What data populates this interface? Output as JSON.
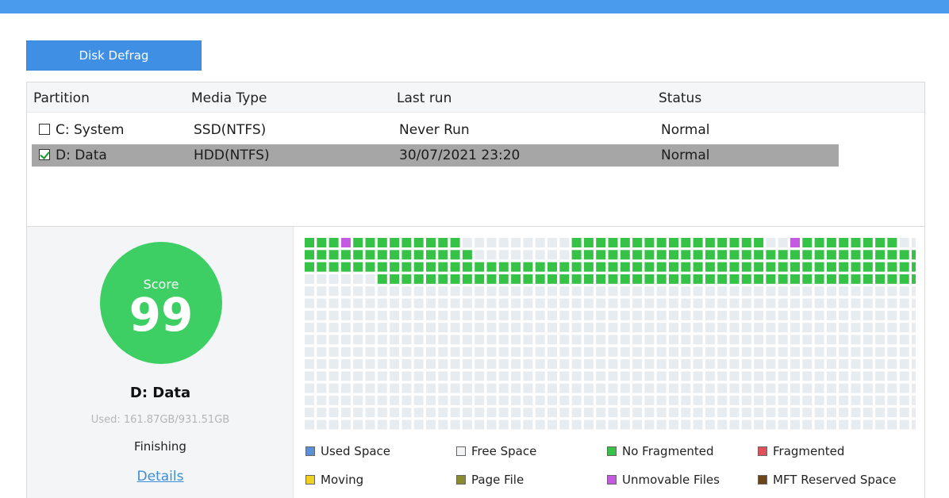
{
  "toolbar": {
    "defrag_label": "Disk Defrag"
  },
  "table": {
    "headers": [
      "Partition",
      "Media Type",
      "Last run",
      "Status"
    ],
    "rows": [
      {
        "checked": false,
        "partition": "C:  System",
        "media": "SSD(NTFS)",
        "last_run": "Never Run",
        "status": "Normal"
      },
      {
        "checked": true,
        "partition": "D:  Data",
        "media": "HDD(NTFS)",
        "last_run": "30/07/2021 23:20",
        "status": "Normal"
      }
    ]
  },
  "info": {
    "score_label": "Score",
    "score_value": "99",
    "drive_name": "D:  Data",
    "used": "Used: 161.87GB/931.51GB",
    "phase": "Finishing",
    "details_link": "Details"
  },
  "cluster_map": {
    "colors": {
      "free": "#e7ecf0",
      "used": "#5b8fd8",
      "no_fragmented": "#36c247",
      "fragmented": "#e0525a",
      "moving": "#f0d020",
      "page_file": "#8a8a30",
      "unmovable": "#c45ae0",
      "mft": "#6b4418"
    },
    "rows": [
      "GGGMGGGGGGGGG.........GGGGGGGGGGGGGGGG..MGGGGGGGG...GG",
      "GGGGGGGGGGGGGG........GGGGGGGGGGGGGGGGGGGGGGGGGGGGGGGG",
      "GGGGGGGGGGGGGGGGGGGGGGGGGGGGGGGGGGGGGGGGGGGGGGGGGGGGGG",
      "......GGGGGGGGGGGGGGGGGGGGGGGGGGGGGGGGGGGGGGGGGGGGGG..",
      "......................................................",
      "......................................................",
      "......................................................",
      "......................................................",
      "......................................................",
      "......................................................",
      "......................................................",
      "......................................................",
      "......................................................",
      "......................................................",
      "......................................................",
      "......................................................"
    ]
  },
  "legend": [
    {
      "label": "Used Space",
      "color": "#5b8fd8"
    },
    {
      "label": "Free Space",
      "color": "#f2f4f6"
    },
    {
      "label": "No Fragmented",
      "color": "#36c247"
    },
    {
      "label": "Fragmented",
      "color": "#e0525a"
    },
    {
      "label": "Moving",
      "color": "#f0d020"
    },
    {
      "label": "Page File",
      "color": "#8a8a30"
    },
    {
      "label": "Unmovable Files",
      "color": "#c45ae0"
    },
    {
      "label": "MFT Reserved Space",
      "color": "#6b4418"
    }
  ]
}
